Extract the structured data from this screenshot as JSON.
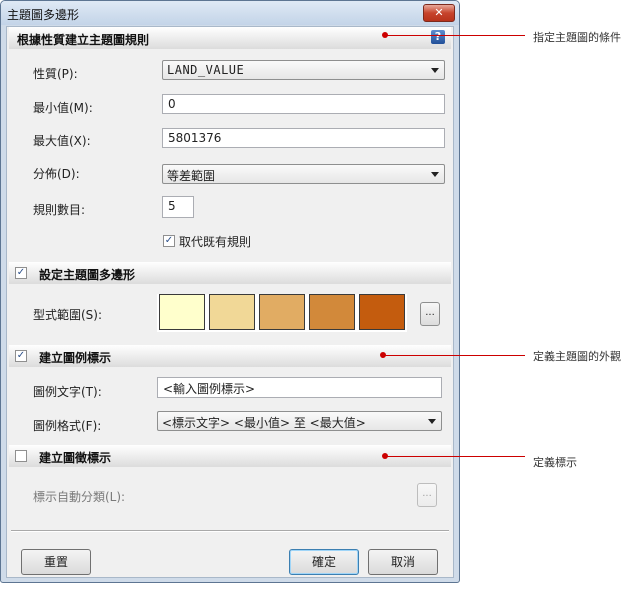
{
  "window": {
    "title": "主題圖多邊形",
    "close_symbol": "✕"
  },
  "section_rule": {
    "title": "根據性質建立主題圖規則",
    "help_symbol": "?",
    "property_label": "性質(P):",
    "property_value": "LAND_VALUE",
    "min_label": "最小值(M):",
    "min_value": "0",
    "max_label": "最大值(X):",
    "max_value": "5801376",
    "distribution_label": "分佈(D):",
    "distribution_value": "等差範圍",
    "rule_count_label": "規則數目:",
    "rule_count_value": "5",
    "replace_checked": true,
    "replace_label": "取代既有規則"
  },
  "section_polygon": {
    "checked": true,
    "title": "設定主題圖多邊形",
    "style_range_label": "型式範圍(S):",
    "swatches": [
      "#ffffcc",
      "#f1d897",
      "#e1ac63",
      "#d2893a",
      "#c45c0e"
    ],
    "more_button": "..."
  },
  "section_legend": {
    "checked": true,
    "title": "建立圖例標示",
    "legend_text_label": "圖例文字(T):",
    "legend_text_value": "<輸入圖例標示>",
    "legend_format_label": "圖例格式(F):",
    "legend_format_value": "<標示文字> <最小值> 至 <最大值>"
  },
  "section_tag": {
    "checked": false,
    "title": "建立圖徵標示",
    "auto_classify_label": "標示自動分類(L):",
    "more_button": "..."
  },
  "buttons": {
    "reset": "重置",
    "ok": "確定",
    "cancel": "取消"
  },
  "callouts": {
    "rule": "指定主題圖的條件",
    "legend": "定義主題圖的外觀",
    "tag": "定義標示"
  },
  "colors": {
    "callout": "#cc0000",
    "window_frame": "#cfdbe9",
    "close_button": "#c7442c"
  }
}
